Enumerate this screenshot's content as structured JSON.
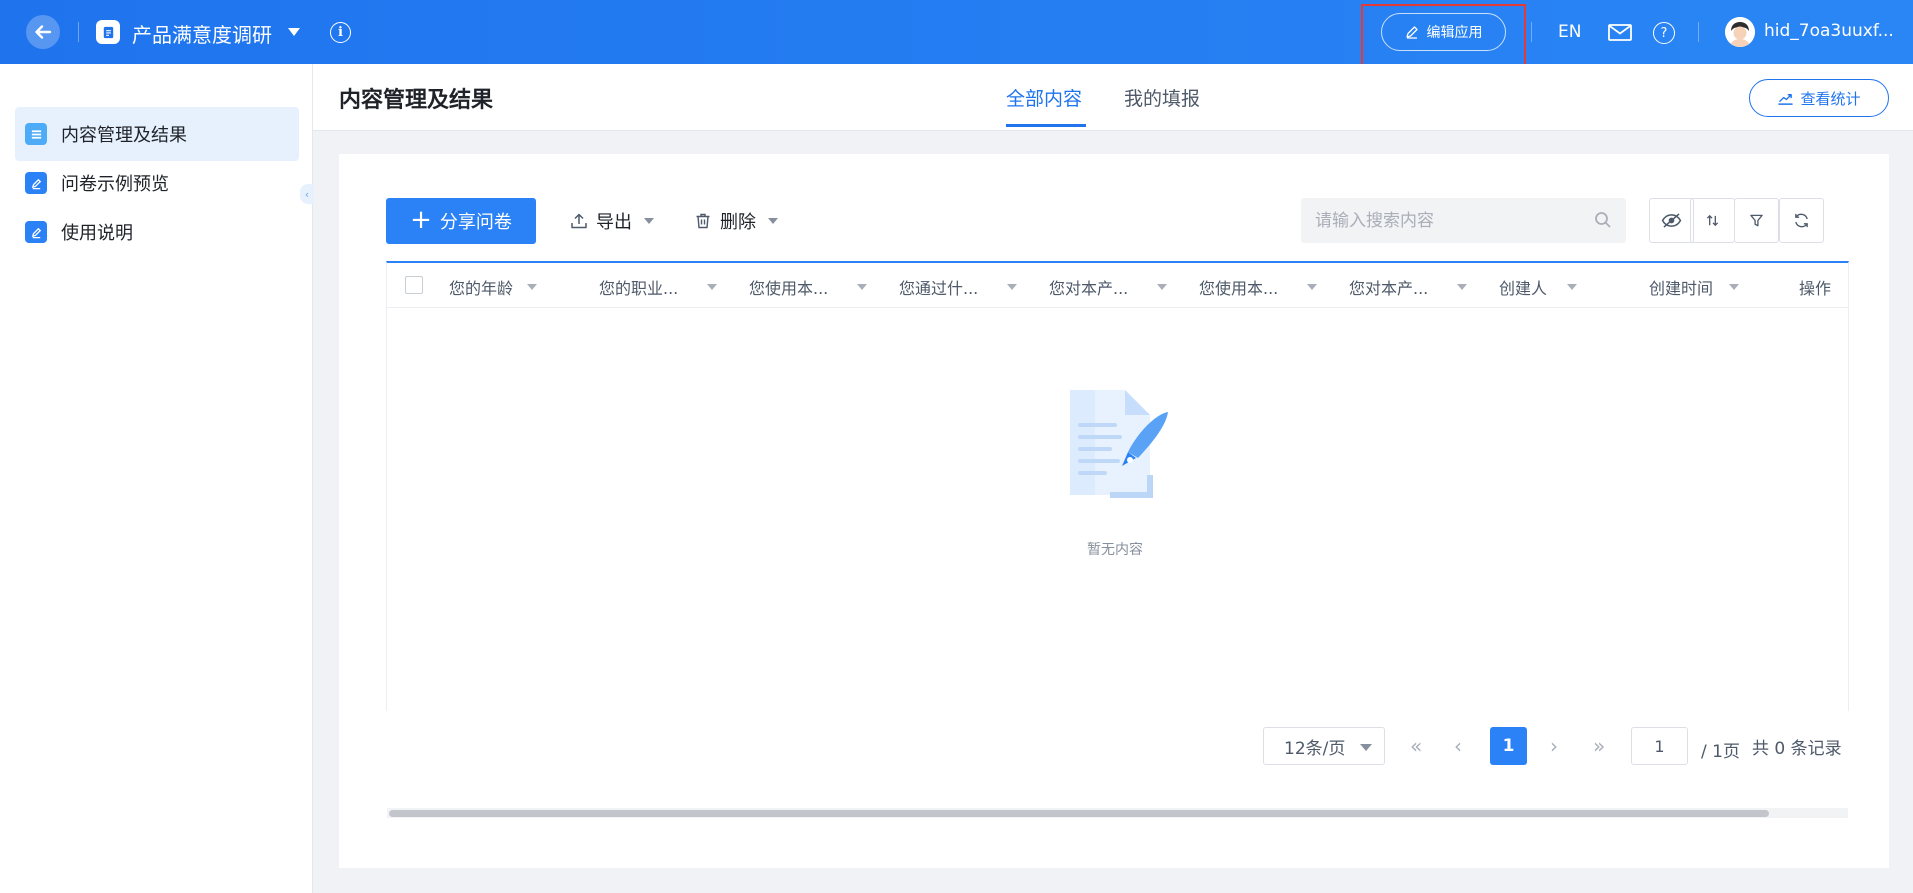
{
  "topbar": {
    "app_title": "产品满意度调研",
    "edit_app_label": "编辑应用",
    "lang_label": "EN",
    "username": "hid_7oa3uuxf..."
  },
  "sidebar": {
    "items": [
      {
        "label": "内容管理及结果",
        "icon": "list-icon",
        "active": true
      },
      {
        "label": "问卷示例预览",
        "icon": "edit-icon",
        "active": false
      },
      {
        "label": "使用说明",
        "icon": "edit-icon",
        "active": false
      }
    ]
  },
  "header": {
    "page_title": "内容管理及结果",
    "tabs": [
      {
        "label": "全部内容",
        "active": true
      },
      {
        "label": "我的填报",
        "active": false
      }
    ],
    "stats_label": "查看统计"
  },
  "toolbar": {
    "share_label": "分享问卷",
    "export_label": "导出",
    "delete_label": "删除",
    "search_placeholder": "请输入搜索内容"
  },
  "table": {
    "columns": [
      "您的年龄",
      "您的职业...",
      "您使用本...",
      "您通过什...",
      "您对本产...",
      "您使用本...",
      "您对本产...",
      "创建人",
      "创建时间",
      "操作"
    ],
    "rows": [],
    "empty_text": "暂无内容"
  },
  "pagination": {
    "page_size": "12条/页",
    "current_page": "1",
    "jump_value": "1",
    "total_pages": "/ 1页",
    "total_records": "共 0 条记录"
  },
  "colors": {
    "primary": "#2b82f6",
    "topbar": "#1f74ee",
    "highlight": "#e53935"
  }
}
